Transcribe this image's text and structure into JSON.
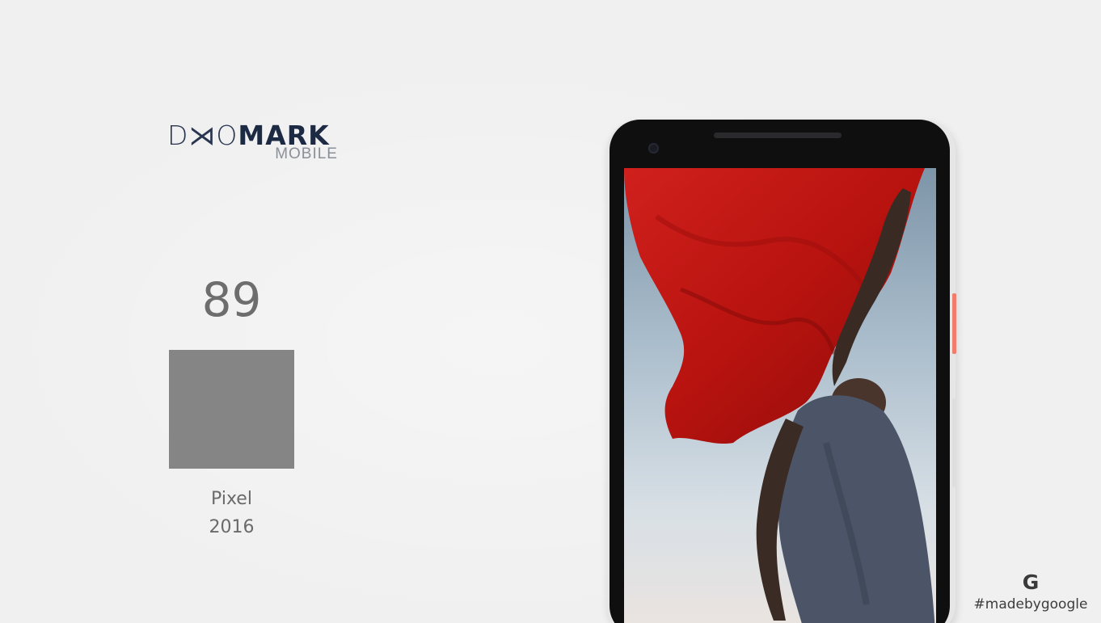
{
  "logo": {
    "part_thin": "D⋊O",
    "part_bold": "MARK",
    "sub": "MOBILE"
  },
  "score": {
    "value": "89",
    "device_name": "Pixel",
    "device_year": "2016",
    "bar_color": "#858585"
  },
  "brand": {
    "logo_letter": "G",
    "hashtag": "#madebygoogle"
  },
  "phone": {
    "accent_color": "#ef7c6c",
    "screen_image": "red-flag-photo",
    "flag_color": "#c61a17"
  }
}
